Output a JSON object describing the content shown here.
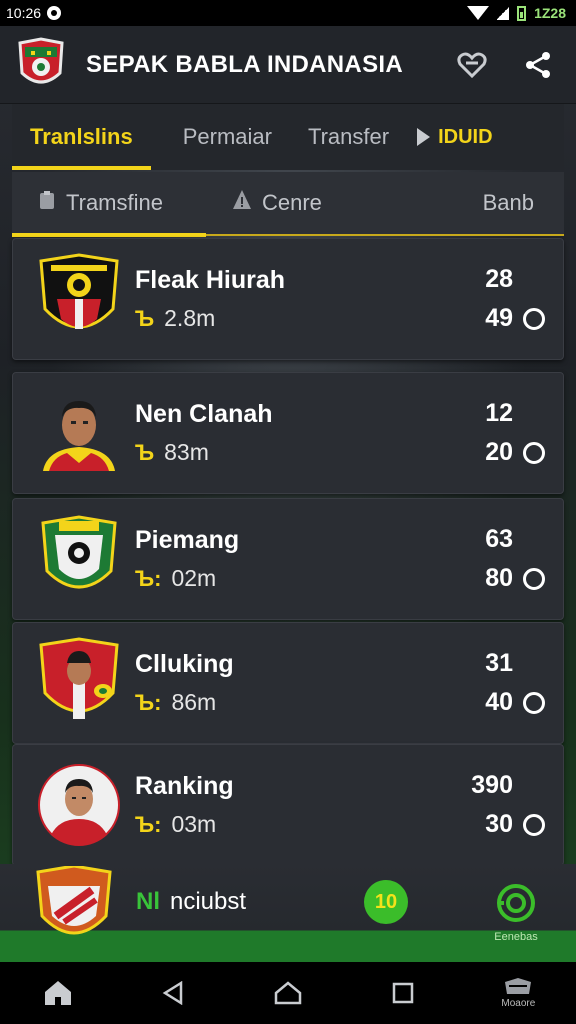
{
  "status_bar": {
    "time": "10:26",
    "right_text": "1Z28"
  },
  "header": {
    "title": "SEPAK BABLA INDANASIA"
  },
  "tabs": [
    {
      "label": "Tranlslins",
      "active": true
    },
    {
      "label": "Permaiar",
      "active": false
    },
    {
      "label": "Transfer",
      "active": false
    }
  ],
  "tab_extra": "IDUID",
  "subtabs": [
    {
      "label": "Tramsfine",
      "icon": "clipboard-icon",
      "active": true
    },
    {
      "label": "Cenre",
      "icon": "lock-icon",
      "active": false
    },
    {
      "label": "Banb",
      "icon": "",
      "active": false
    }
  ],
  "items": [
    {
      "name": "Fleak Hiurah",
      "sub": "2.8m",
      "stat_top": "28",
      "stat_bottom": "49",
      "crest": "club-crest-black-red"
    },
    {
      "name": "Nen Clanah",
      "sub": "83m",
      "stat_top": "12",
      "stat_bottom": "20",
      "crest": "player-portrait"
    },
    {
      "name": "Piemang",
      "sub": "02m",
      "stat_top": "63",
      "stat_bottom": "80",
      "crest": "club-crest-green"
    },
    {
      "name": "Clluking",
      "sub": "86m",
      "stat_top": "31",
      "stat_bottom": "40",
      "crest": "club-crest-red-player"
    },
    {
      "name": "Ranking",
      "sub": "03m",
      "stat_top": "390",
      "stat_bottom": "30",
      "crest": "player-portrait-round"
    }
  ],
  "bottom_bar": {
    "prefix": "Nl",
    "label": "nciubst",
    "badge": "10",
    "right_label": "Eenebas"
  },
  "nav_bar": {
    "right_label": "Moaore"
  },
  "colors": {
    "accent": "#f3d41a",
    "card": "#2a2d33",
    "green": "#1f7a2a"
  }
}
